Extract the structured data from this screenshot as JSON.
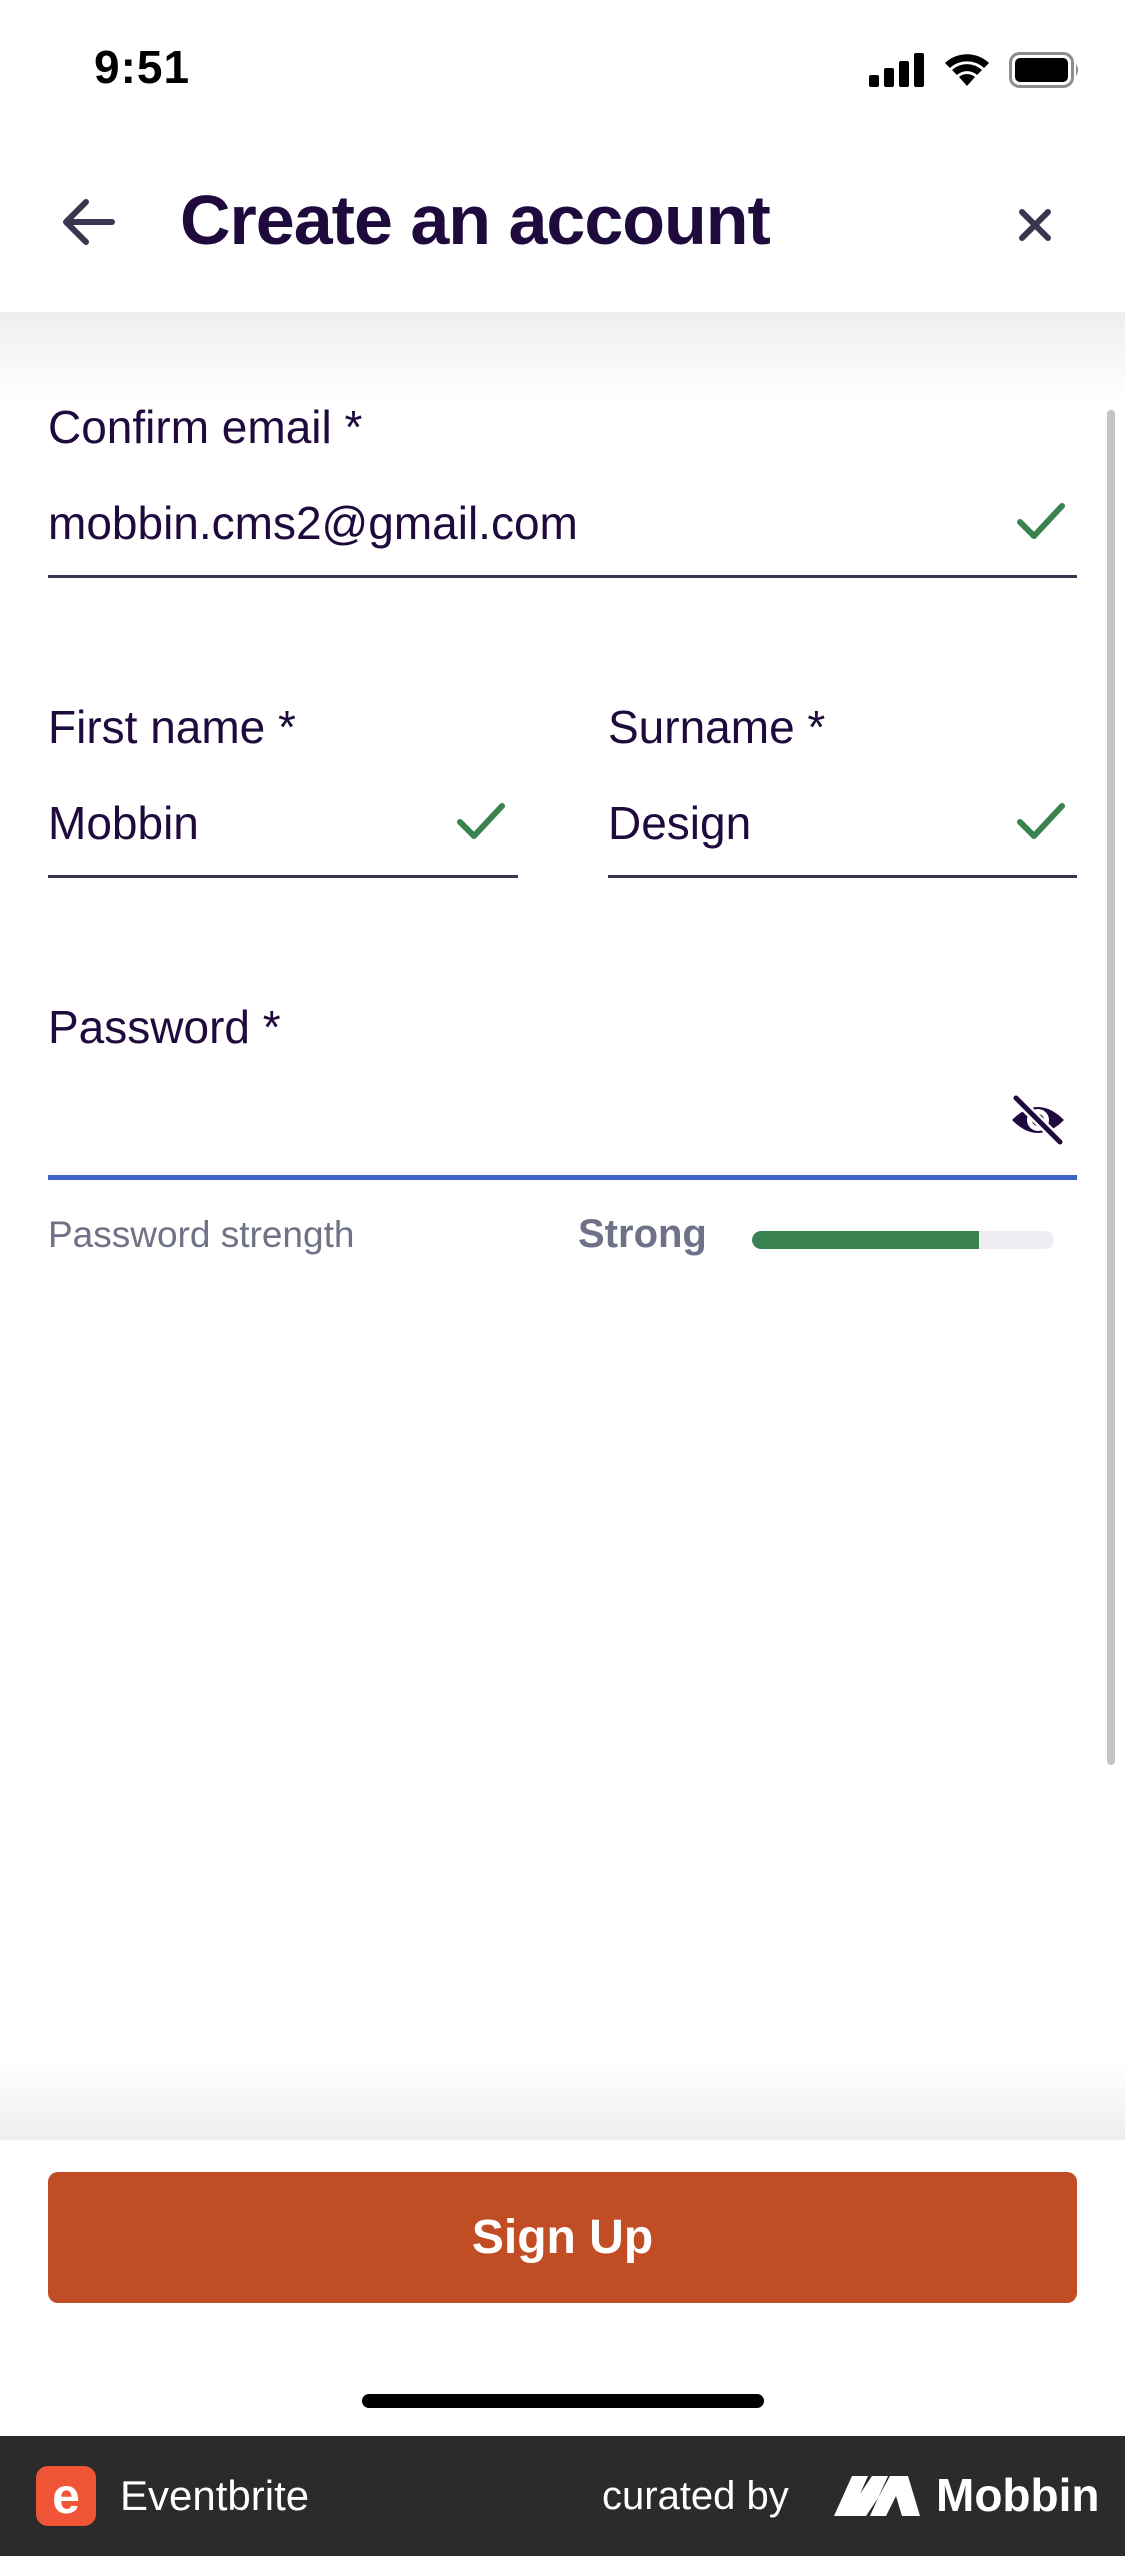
{
  "status_bar": {
    "time": "9:51"
  },
  "header": {
    "title": "Create an account",
    "back_icon": "arrow-left-icon",
    "close_icon": "close-icon"
  },
  "form": {
    "confirm_email": {
      "label": "Confirm email *",
      "value": "mobbin.cms2@gmail.com"
    },
    "first_name": {
      "label": "First name *",
      "value": "Mobbin"
    },
    "surname": {
      "label": "Surname *",
      "value": "Design"
    },
    "password": {
      "label": "Password *",
      "value": "",
      "toggle_icon": "eye-slash-icon"
    },
    "password_strength": {
      "label": "Password strength",
      "value": "Strong",
      "level": 0.75
    }
  },
  "signup_button": {
    "label": "Sign Up"
  },
  "footer": {
    "brand_letter": "e",
    "brand_name": "Eventbrite",
    "curated_by": "curated by",
    "curator": "Mobbin"
  },
  "colors": {
    "primary_text": "#1e0a3c",
    "accent_orange": "#c14d24",
    "success_green": "#3a8250",
    "focus_blue": "#3d64c6",
    "eventbrite_orange": "#f05537"
  }
}
